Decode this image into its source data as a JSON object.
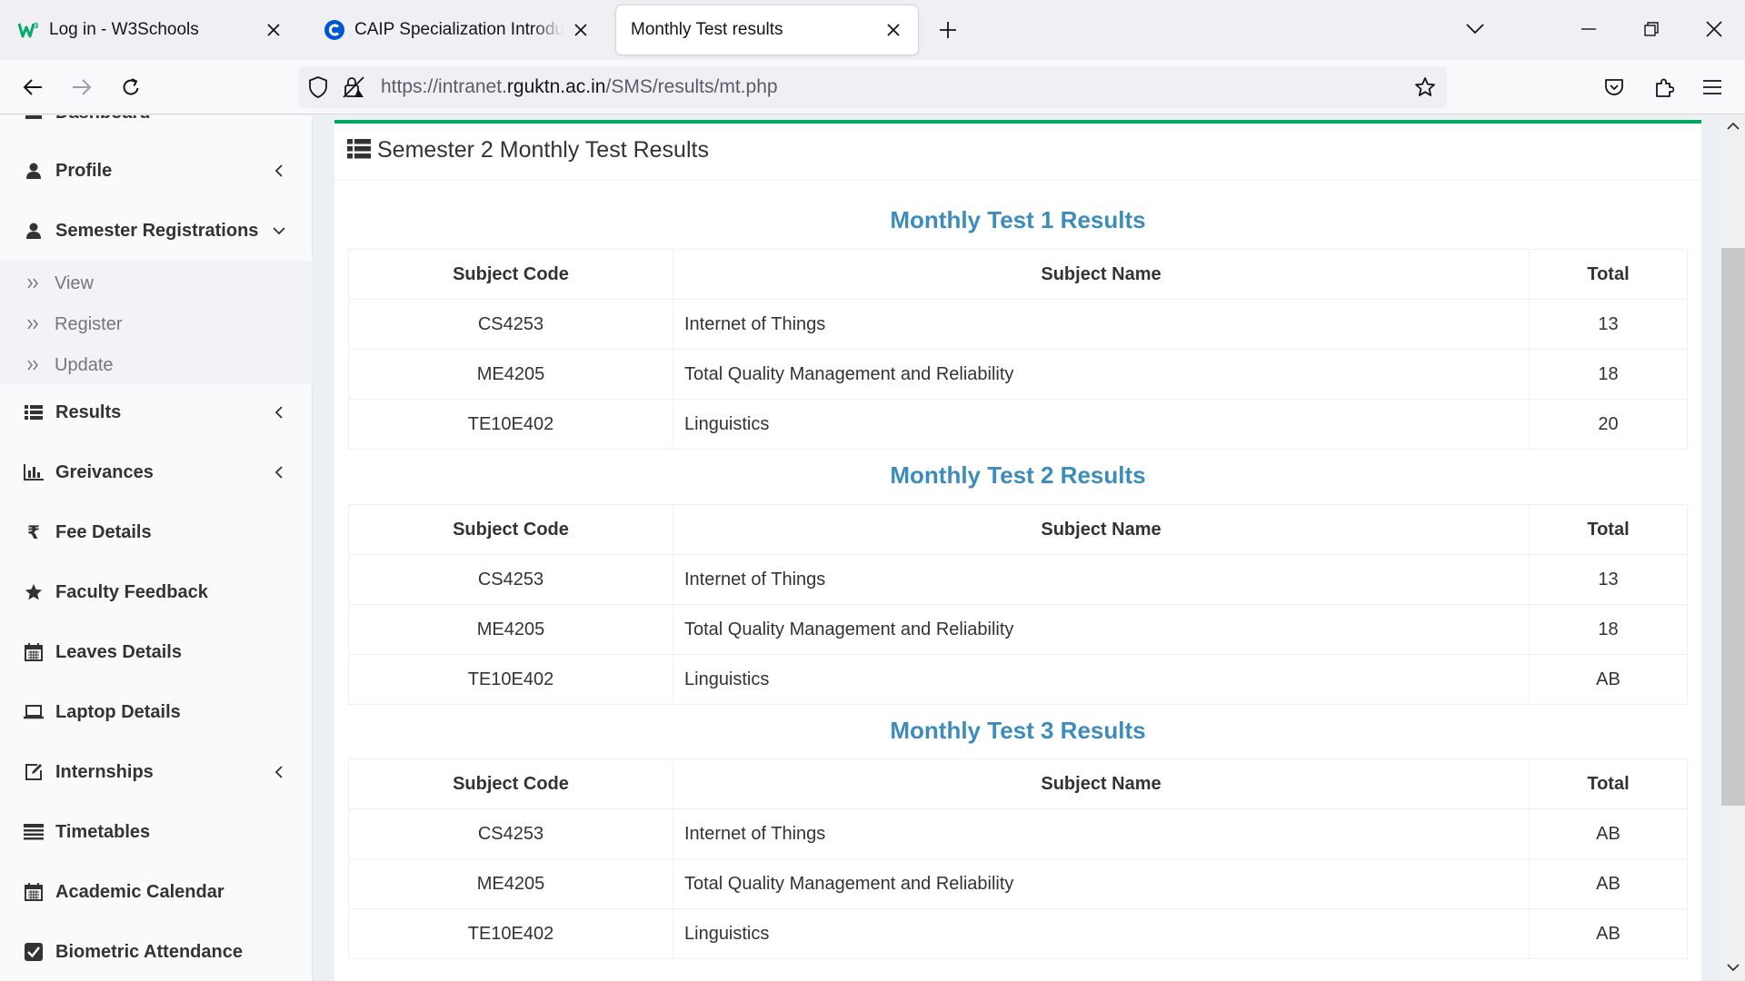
{
  "browser": {
    "tabs": [
      {
        "title": "Log in - W3Schools",
        "icon": "w3schools-logo"
      },
      {
        "title": "CAIP Specialization Introduction",
        "icon": "coursera-logo"
      },
      {
        "title": "Monthly Test results",
        "icon": "none",
        "active": true
      }
    ],
    "url": {
      "prefix": "https://intranet.",
      "host": "rguktn.ac.in",
      "path": "/SMS/results/mt.php"
    }
  },
  "sidebar": {
    "items": [
      {
        "label": "Dashboard",
        "icon": "dashboard-icon"
      },
      {
        "label": "Profile",
        "icon": "user-icon",
        "arrow": "chevron-left"
      },
      {
        "label": "Semester Registrations",
        "icon": "user-icon",
        "arrow": "chevron-down"
      },
      {
        "label": "Results",
        "icon": "list-icon",
        "arrow": "chevron-left"
      },
      {
        "label": "Greivances",
        "icon": "bar-chart-icon",
        "arrow": "chevron-left"
      },
      {
        "label": "Fee Details",
        "icon": "rupee-icon"
      },
      {
        "label": "Faculty Feedback",
        "icon": "star-icon"
      },
      {
        "label": "Leaves Details",
        "icon": "calendar-icon"
      },
      {
        "label": "Laptop Details",
        "icon": "laptop-icon"
      },
      {
        "label": "Internships",
        "icon": "edit-icon",
        "arrow": "chevron-left"
      },
      {
        "label": "Timetables",
        "icon": "table-icon"
      },
      {
        "label": "Academic Calendar",
        "icon": "calendar-icon"
      },
      {
        "label": "Biometric Attendance",
        "icon": "check-square-icon"
      }
    ],
    "submenu": [
      {
        "label": "View"
      },
      {
        "label": "Register"
      },
      {
        "label": "Update"
      }
    ]
  },
  "main": {
    "title": "Semester 2 Monthly Test Results",
    "columns": [
      "Subject Code",
      "Subject Name",
      "Total"
    ],
    "tests": [
      {
        "heading": "Monthly Test 1 Results",
        "rows": [
          {
            "code": "CS4253",
            "name": "Internet of Things",
            "total": "13"
          },
          {
            "code": "ME4205",
            "name": "Total Quality Management and Reliability",
            "total": "18"
          },
          {
            "code": "TE10E402",
            "name": "Linguistics",
            "total": "20"
          }
        ]
      },
      {
        "heading": "Monthly Test 2 Results",
        "rows": [
          {
            "code": "CS4253",
            "name": "Internet of Things",
            "total": "13"
          },
          {
            "code": "ME4205",
            "name": "Total Quality Management and Reliability",
            "total": "18"
          },
          {
            "code": "TE10E402",
            "name": "Linguistics",
            "total": "AB"
          }
        ]
      },
      {
        "heading": "Monthly Test 3 Results",
        "rows": [
          {
            "code": "CS4253",
            "name": "Internet of Things",
            "total": "AB"
          },
          {
            "code": "ME4205",
            "name": "Total Quality Management and Reliability",
            "total": "AB"
          },
          {
            "code": "TE10E402",
            "name": "Linguistics",
            "total": "AB"
          }
        ]
      }
    ]
  },
  "colors": {
    "accent": "#3c8dbc",
    "box_border": "#00a65a",
    "sidebar_bg": "#f9fafc"
  }
}
